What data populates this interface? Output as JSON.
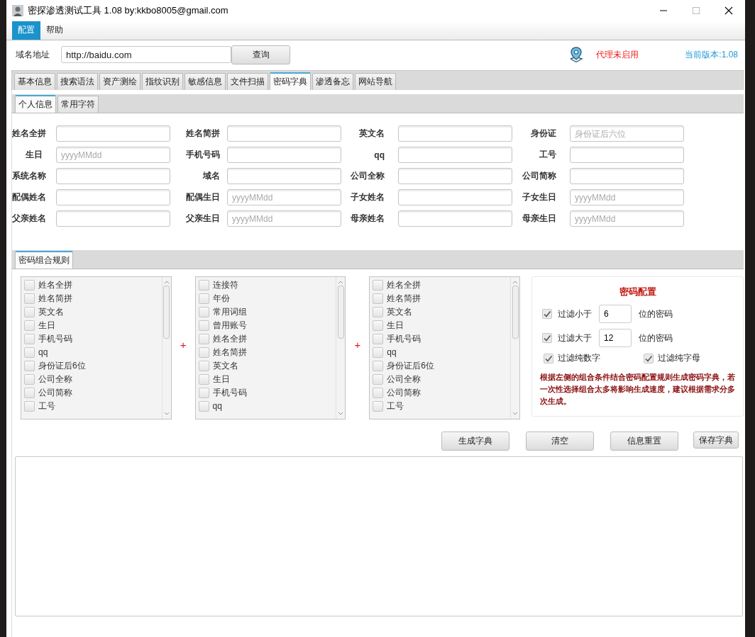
{
  "window": {
    "title": "密探渗透测试工具 1.08 by:kkbo8005@gmail.com"
  },
  "menu": [
    {
      "label": "配置",
      "selected": true
    },
    {
      "label": "帮助",
      "selected": false
    }
  ],
  "toolbar": {
    "domain_label": "域名地址",
    "domain_value": "http://baidu.com",
    "query_button": "查询",
    "proxy_status": "代理未启用",
    "version": "当前版本:1.08"
  },
  "tabs": [
    {
      "label": "基本信息",
      "selected": false
    },
    {
      "label": "搜索语法",
      "selected": false
    },
    {
      "label": "资产测绘",
      "selected": false
    },
    {
      "label": "指纹识别",
      "selected": false
    },
    {
      "label": "敏感信息",
      "selected": false
    },
    {
      "label": "文件扫描",
      "selected": false
    },
    {
      "label": "密码字典",
      "selected": true
    },
    {
      "label": "渗透备忘",
      "selected": false
    },
    {
      "label": "网站导航",
      "selected": false
    }
  ],
  "subtabs": [
    {
      "label": "个人信息",
      "selected": true
    },
    {
      "label": "常用字符",
      "selected": false
    }
  ],
  "form_fields": [
    {
      "label": "姓名全拼"
    },
    {
      "label": "姓名简拼"
    },
    {
      "label": "英文名"
    },
    {
      "label": "身份证",
      "placeholder": "身份证后六位"
    },
    {
      "label": "生日",
      "placeholder": "yyyyMMdd"
    },
    {
      "label": "手机号码"
    },
    {
      "label": "qq"
    },
    {
      "label": "工号"
    },
    {
      "label": "系统名称"
    },
    {
      "label": "域名"
    },
    {
      "label": "公司全称"
    },
    {
      "label": "公司简称"
    },
    {
      "label": "配偶姓名"
    },
    {
      "label": "配偶生日",
      "placeholder": "yyyyMMdd"
    },
    {
      "label": "子女姓名"
    },
    {
      "label": "子女生日",
      "placeholder": "yyyyMMdd"
    },
    {
      "label": "父亲姓名"
    },
    {
      "label": "父亲生日",
      "placeholder": "yyyyMMdd"
    },
    {
      "label": "母亲姓名"
    },
    {
      "label": "母亲生日",
      "placeholder": "yyyyMMdd"
    }
  ],
  "rules_tabs": [
    {
      "label": "密码组合规则",
      "selected": true
    }
  ],
  "lists": [
    {
      "items": [
        {
          "label": "姓名全拼",
          "checked": false
        },
        {
          "label": "姓名简拼",
          "checked": false
        },
        {
          "label": "英文名",
          "checked": false
        },
        {
          "label": "生日",
          "checked": false
        },
        {
          "label": "手机号码",
          "checked": false
        },
        {
          "label": "qq",
          "checked": false
        },
        {
          "label": "身份证后6位",
          "checked": false
        },
        {
          "label": "公司全称",
          "checked": false
        },
        {
          "label": "公司简称",
          "checked": false
        },
        {
          "label": "工号",
          "checked": false
        }
      ]
    },
    {
      "items": [
        {
          "label": "连接符",
          "checked": false
        },
        {
          "label": "年份",
          "checked": false
        },
        {
          "label": "常用词组",
          "checked": false
        },
        {
          "label": "曾用账号",
          "checked": false
        },
        {
          "label": "姓名全拼",
          "checked": false
        },
        {
          "label": "姓名简拼",
          "checked": false
        },
        {
          "label": "英文名",
          "checked": false
        },
        {
          "label": "生日",
          "checked": false
        },
        {
          "label": "手机号码",
          "checked": false
        },
        {
          "label": "qq",
          "checked": false
        }
      ]
    },
    {
      "items": [
        {
          "label": "姓名全拼",
          "checked": false
        },
        {
          "label": "姓名简拼",
          "checked": false
        },
        {
          "label": "英文名",
          "checked": false
        },
        {
          "label": "生日",
          "checked": false
        },
        {
          "label": "手机号码",
          "checked": false
        },
        {
          "label": "qq",
          "checked": false
        },
        {
          "label": "身份证后6位",
          "checked": false
        },
        {
          "label": "公司全称",
          "checked": false
        },
        {
          "label": "公司简称",
          "checked": false
        },
        {
          "label": "工号",
          "checked": false
        }
      ]
    }
  ],
  "list_separators": [
    "+",
    "+"
  ],
  "config": {
    "title": "密码配置",
    "length_filters": [
      {
        "label": "过滤小于",
        "checked": true,
        "value": "6",
        "suffix": "位的密码"
      },
      {
        "label": "过滤大于",
        "checked": true,
        "value": "12",
        "suffix": "位的密码"
      }
    ],
    "type_filters": [
      {
        "label": "过滤纯数字",
        "checked": true
      },
      {
        "label": "过滤纯字母",
        "checked": true
      }
    ],
    "note": "根据左侧的组合条件结合密码配置规则生成密码字典，若一次性选择组合太多将影响生成速度，建议根据需求分多次生成。"
  },
  "buttons": [
    {
      "label": "生成字典",
      "kind": "large"
    },
    {
      "label": "清空",
      "kind": "large"
    },
    {
      "label": "信息重置",
      "kind": "large"
    },
    {
      "label": "保存字典",
      "kind": "small"
    }
  ]
}
